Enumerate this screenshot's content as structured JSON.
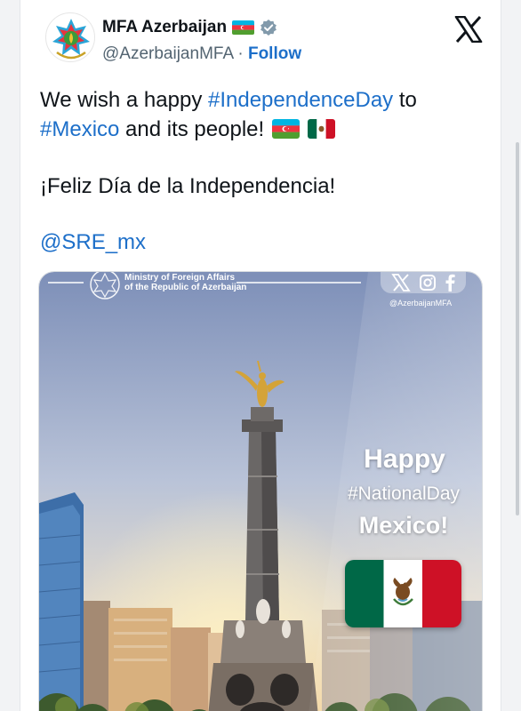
{
  "header": {
    "display_name": "MFA Azerbaijan",
    "handle": "@AzerbaijanMFA",
    "separator": " · ",
    "follow_label": "Follow"
  },
  "icons": {
    "avatar": "azerbaijan-emblem",
    "name_flag": "azerbaijan-flag",
    "badge": "verified-badge",
    "platform": "x-logo"
  },
  "tweet": {
    "text_before": "We wish a happy ",
    "hashtag_1": "#IndependenceDay",
    "text_middle": " to ",
    "hashtag_2": "#Mexico",
    "text_after": " and its people!",
    "spanish_line": "¡Feliz Día de la Independencia!",
    "mention": "@SRE_mx"
  },
  "media": {
    "ministry_line_1": "Ministry of Foreign Affairs",
    "ministry_line_2": "of the Republic of Azerbaijan",
    "social_handle": "@AzerbaijanMFA",
    "social_icons": [
      "x-icon",
      "instagram-icon",
      "facebook-icon"
    ],
    "greeting": "Happy",
    "hashtag": "#NationalDay",
    "country": "Mexico!"
  },
  "colors": {
    "link": "#1d6fc9",
    "text": "#0f1419",
    "muted": "#536471",
    "az_blue": "#00b5e2",
    "az_red": "#ef3340",
    "az_green": "#509e2f",
    "mx_green": "#006847",
    "mx_red": "#ce1126"
  }
}
